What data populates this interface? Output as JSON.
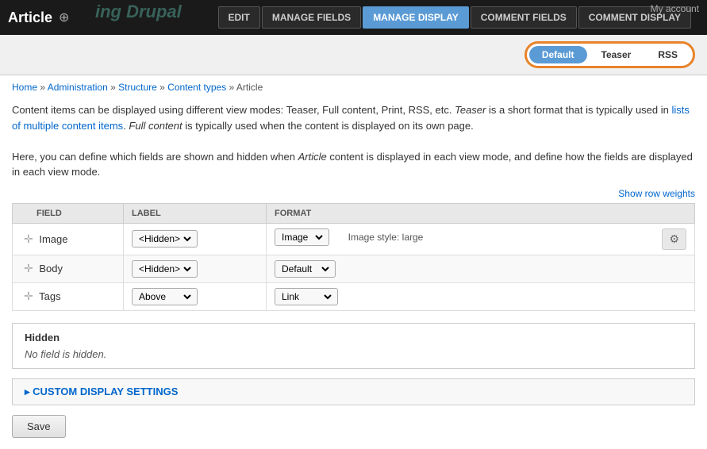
{
  "header": {
    "article_title": "Article",
    "add_icon": "⊕",
    "drupal_text": "ing Drupal",
    "my_account": "My account",
    "tabs": [
      {
        "label": "EDIT",
        "id": "edit",
        "active": false
      },
      {
        "label": "MANAGE FIELDS",
        "id": "manage-fields",
        "active": false
      },
      {
        "label": "MANAGE DISPLAY",
        "id": "manage-display",
        "active": true
      },
      {
        "label": "COMMENT FIELDS",
        "id": "comment-fields",
        "active": false
      },
      {
        "label": "COMMENT DISPLAY",
        "id": "comment-display",
        "active": false
      }
    ]
  },
  "view_modes": {
    "tabs": [
      {
        "label": "Default",
        "active": true
      },
      {
        "label": "Teaser",
        "active": false
      },
      {
        "label": "RSS",
        "active": false
      }
    ]
  },
  "breadcrumb": {
    "items": [
      "Home",
      "Administration",
      "Structure",
      "Content types",
      "Article"
    ],
    "separator": "»"
  },
  "description": {
    "line1": "Content items can be displayed using different view modes: Teaser, Full content, Print, RSS, etc. ",
    "line1_italic": "Teaser",
    "line1_cont": " is a short format that is typically used in lists of multiple content items. ",
    "line1_italic2": "Full content",
    "line1_cont2": " is typically used when the content is displayed on its own page.",
    "line2": "Here, you can define which fields are shown and hidden when ",
    "line2_italic": "Article",
    "line2_cont": " content is displayed in each view mode, and define how the fields are displayed in each view mode."
  },
  "show_row_weights": "Show row weights",
  "table": {
    "headers": [
      "FIELD",
      "LABEL",
      "FORMAT"
    ],
    "rows": [
      {
        "field": "Image",
        "label_value": "<Hidden>",
        "format_value": "Image",
        "extra": "Image style: large",
        "has_gear": true
      },
      {
        "field": "Body",
        "label_value": "<Hidden>",
        "format_value": "Default",
        "extra": "",
        "has_gear": false
      },
      {
        "field": "Tags",
        "label_value": "Above",
        "format_value": "Link",
        "extra": "",
        "has_gear": false
      }
    ]
  },
  "hidden_section": {
    "label": "Hidden",
    "empty_text": "No field is hidden."
  },
  "custom_settings": {
    "label": "▸ CUSTOM DISPLAY SETTINGS"
  },
  "save_button": "Save",
  "colors": {
    "accent_orange": "#e8832a",
    "link_blue": "#0066cc",
    "active_tab_blue": "#5b9bd5"
  }
}
